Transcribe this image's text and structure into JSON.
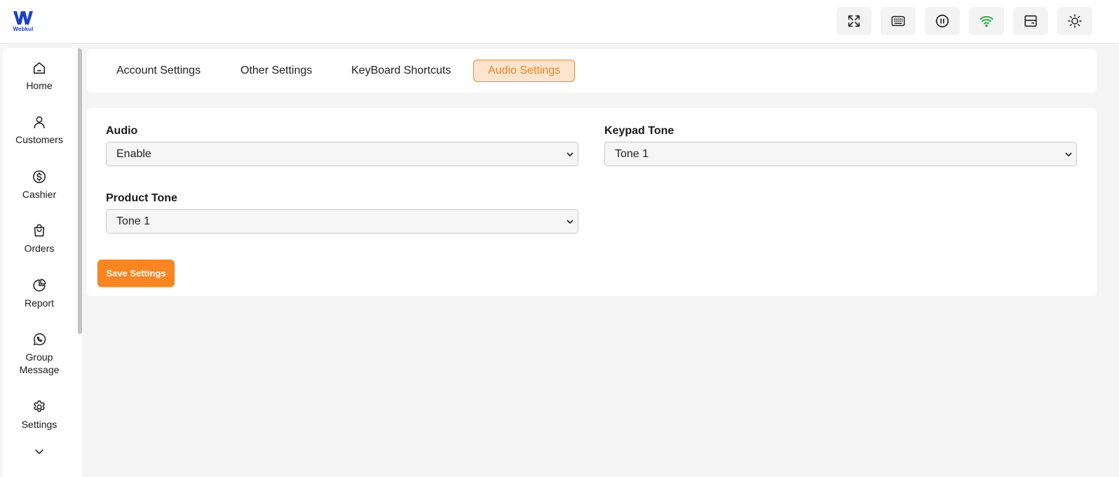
{
  "brand": {
    "name": "Webkul",
    "color": "#1b3fc9",
    "accent": "#fb8520",
    "wifi_color": "#1aa33a"
  },
  "header": {
    "buttons": [
      {
        "icon": "fullscreen-icon"
      },
      {
        "icon": "keyboard-icon"
      },
      {
        "icon": "pause-icon"
      },
      {
        "icon": "wifi-icon"
      },
      {
        "icon": "cash-drawer-icon"
      },
      {
        "icon": "sun-icon"
      }
    ]
  },
  "sidebar": {
    "items": [
      {
        "label": "Home",
        "icon": "home-icon"
      },
      {
        "label": "Customers",
        "icon": "user-icon"
      },
      {
        "label": "Cashier",
        "icon": "dollar-icon"
      },
      {
        "label": "Orders",
        "icon": "shopping-bag-icon"
      },
      {
        "label": "Report",
        "icon": "pie-chart-icon"
      },
      {
        "label": "Group Message",
        "icon": "whatsapp-icon"
      },
      {
        "label": "Settings",
        "icon": "gear-icon"
      }
    ],
    "more_icon": "chevron-down-icon"
  },
  "tabs": [
    {
      "label": "Account Settings",
      "active": false
    },
    {
      "label": "Other Settings",
      "active": false
    },
    {
      "label": "KeyBoard Shortcuts",
      "active": false
    },
    {
      "label": "Audio Settings",
      "active": true
    }
  ],
  "form": {
    "audio": {
      "label": "Audio",
      "value": "Enable"
    },
    "keypad_tone": {
      "label": "Keypad Tone",
      "value": "Tone 1"
    },
    "product_tone": {
      "label": "Product Tone",
      "value": "Tone 1"
    },
    "save_label": "Save Settings"
  }
}
